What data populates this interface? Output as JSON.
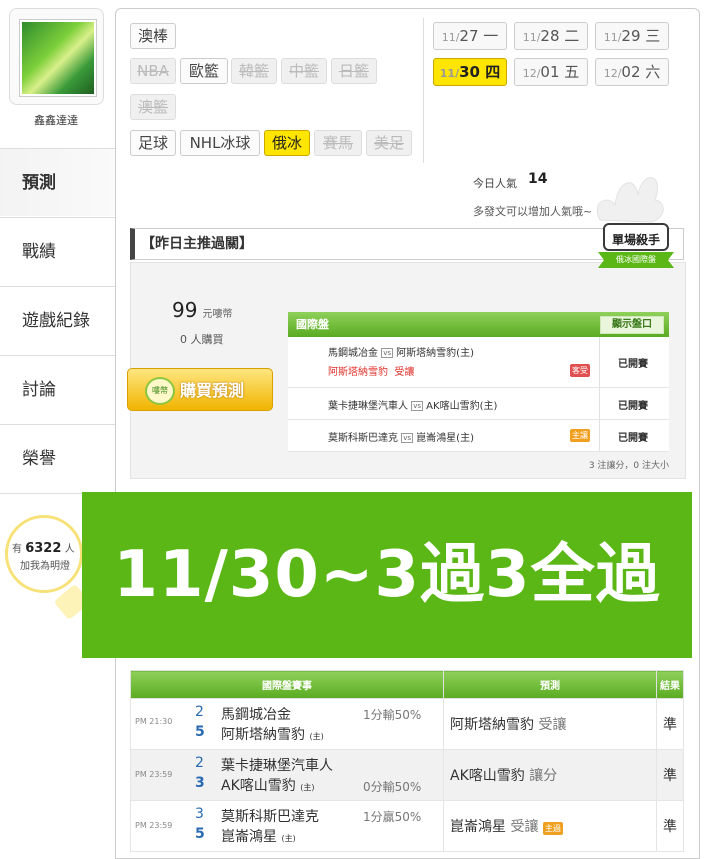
{
  "user": {
    "name": "鑫鑫達達"
  },
  "nav": [
    {
      "label": "預測",
      "active": true
    },
    {
      "label": "戰績"
    },
    {
      "label": "遊戲紀錄"
    },
    {
      "label": "討論"
    },
    {
      "label": "榮譽"
    }
  ],
  "sports": {
    "row1": [
      {
        "label": "澳棒"
      }
    ],
    "row2": [
      {
        "label": "NBA",
        "disabled": true
      },
      {
        "label": "歐籃"
      },
      {
        "label": "韓籃",
        "disabled": true
      },
      {
        "label": "中籃",
        "disabled": true
      },
      {
        "label": "日籃",
        "disabled": true
      }
    ],
    "row3": [
      {
        "label": "澳籃",
        "disabled": true
      }
    ],
    "row4": [
      {
        "label": "足球"
      },
      {
        "label": "NHL冰球"
      },
      {
        "label": "俄冰",
        "selected": true
      },
      {
        "label": "賽馬",
        "disabled": true
      },
      {
        "label": "美足",
        "disabled": true
      }
    ]
  },
  "dates": [
    {
      "m": "11/",
      "d": "27",
      "w": "一"
    },
    {
      "m": "11/",
      "d": "28",
      "w": "二"
    },
    {
      "m": "11/",
      "d": "29",
      "w": "三"
    },
    {
      "m": "11/",
      "d": "30",
      "w": "四",
      "selected": true
    },
    {
      "m": "12/",
      "d": "01",
      "w": "五"
    },
    {
      "m": "12/",
      "d": "02",
      "w": "六"
    }
  ],
  "popularity": {
    "label": "今日人氣",
    "value": "14",
    "hint": "多發文可以增加人氣哦~"
  },
  "section_title": "【昨日主推過關】",
  "badge": {
    "top": "單場殺手",
    "bottom": "俄冰國際盤"
  },
  "price": {
    "amount": "99",
    "unit": "元嘍幣",
    "buyers": "0",
    "buyers_unit": "人購買"
  },
  "buy_button": {
    "label": "購買預測",
    "coin": "嘍幣"
  },
  "intl": {
    "title": "國際盤",
    "show_btn": "顯示盤口",
    "vs": "vs",
    "rows": [
      {
        "home": "馬鋼城冶金",
        "away": "阿斯塔納雪豹(主)",
        "pick": "阿斯塔納雪豹",
        "pick_type": "受讓",
        "tag": "客受",
        "status": "已開賽"
      },
      {
        "home": "葉卡捷琳堡汽車人",
        "away": "AK喀山雪豹(主)",
        "status": "已開賽"
      },
      {
        "home": "莫斯科斯巴達克",
        "away": "崑崙鴻星(主)",
        "tag": "主讓",
        "status": "已開賽"
      }
    ],
    "footer": "3 注讓分，0 注大小"
  },
  "fans": {
    "prefix": "有",
    "count": "6322",
    "suffix": "人",
    "cta": "加我為明燈"
  },
  "banner": "11/30~3過3全過",
  "results": {
    "headers": [
      "國際盤賽事",
      "預測",
      "結果"
    ],
    "rows": [
      {
        "time": "PM 21:30",
        "n1": "2",
        "team1": "馬鋼城冶金",
        "n2": "5",
        "team2": "阿斯塔納雪豹",
        "home_mark": "(主)",
        "line": "1分輸50%",
        "pick": "阿斯塔納雪豹",
        "pick_type": "受讓",
        "tag": "",
        "result": "準"
      },
      {
        "time": "PM 23:59",
        "n1": "2",
        "team1": "葉卡捷琳堡汽車人",
        "n2": "3",
        "team2": "AK喀山雪豹",
        "home_mark": "(主)",
        "line": "0分輸50%",
        "pick": "AK喀山雪豹",
        "pick_type": "讓分",
        "tag": "",
        "result": "準"
      },
      {
        "time": "PM 23:59",
        "n1": "3",
        "team1": "莫斯科斯巴達克",
        "n2": "5",
        "team2": "崑崙鴻星",
        "home_mark": "(主)",
        "line": "1分贏50%",
        "pick": "崑崙鴻星",
        "pick_type": "受讓",
        "tag": "主過",
        "result": "準"
      }
    ]
  },
  "colors": {
    "accent_green": "#5bb715",
    "highlight_yellow": "#ffe500",
    "alert_red": "#e0302a"
  }
}
